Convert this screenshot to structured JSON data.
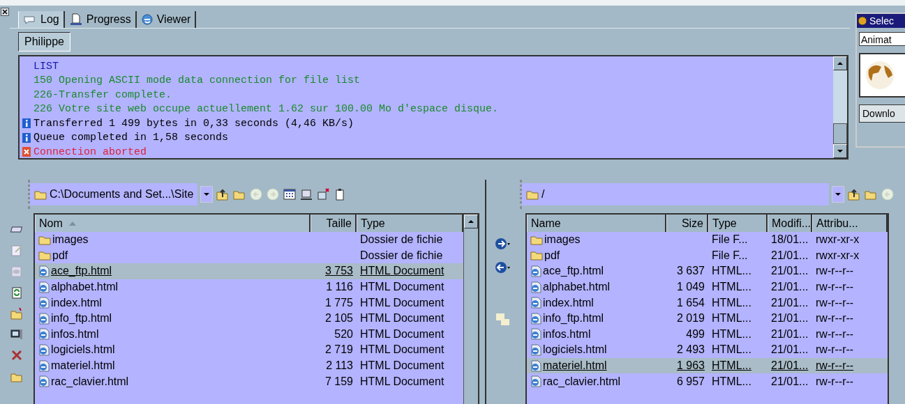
{
  "log_panel": {
    "tabs": [
      {
        "label": "Log",
        "selected": true
      },
      {
        "label": "Progress",
        "selected": false
      },
      {
        "label": "Viewer",
        "selected": false
      }
    ],
    "user_button": "Philippe",
    "lines": [
      {
        "kind": "command",
        "text": "LIST"
      },
      {
        "kind": "reply",
        "text": "150 Opening ASCII mode data connection for file list"
      },
      {
        "kind": "reply",
        "text": "226-Transfer complete."
      },
      {
        "kind": "reply",
        "text": "226 Votre site web occupe actuellement 1.62 sur 100.00 Mo d'espace disque."
      },
      {
        "kind": "info",
        "text": "Transferred 1 499 bytes in 0,33 seconds (4,46 KB/s)"
      },
      {
        "kind": "info",
        "text": "Queue completed in 1,58 seconds"
      },
      {
        "kind": "error",
        "text": "Connection aborted"
      }
    ]
  },
  "side_panel": {
    "title": "Selec",
    "dropdown": "Animat",
    "button": "Downlo"
  },
  "local_pane": {
    "path": "C:\\Documents and Set...\\Site",
    "columns": [
      {
        "label": "Nom",
        "sorted": true
      },
      {
        "label": "Taille",
        "sorted": false
      },
      {
        "label": "Type",
        "sorted": false
      }
    ],
    "rows": [
      {
        "kind": "folder",
        "cells": [
          "images",
          "",
          "Dossier de fichie"
        ],
        "selected": false
      },
      {
        "kind": "folder",
        "cells": [
          "pdf",
          "",
          "Dossier de fichie"
        ],
        "selected": false
      },
      {
        "kind": "file",
        "cells": [
          "ace_ftp.html",
          "3 753",
          "HTML Document"
        ],
        "selected": true
      },
      {
        "kind": "file",
        "cells": [
          "alphabet.html",
          "1 116",
          "HTML Document"
        ],
        "selected": false
      },
      {
        "kind": "file",
        "cells": [
          "index.html",
          "1 775",
          "HTML Document"
        ],
        "selected": false
      },
      {
        "kind": "file",
        "cells": [
          "info_ftp.html",
          "2 105",
          "HTML Document"
        ],
        "selected": false
      },
      {
        "kind": "file",
        "cells": [
          "infos.html",
          "520",
          "HTML Document"
        ],
        "selected": false
      },
      {
        "kind": "file",
        "cells": [
          "logiciels.html",
          "2 719",
          "HTML Document"
        ],
        "selected": false
      },
      {
        "kind": "file",
        "cells": [
          "materiel.html",
          "2 113",
          "HTML Document"
        ],
        "selected": false
      },
      {
        "kind": "file",
        "cells": [
          "rac_clavier.html",
          "7 159",
          "HTML Document"
        ],
        "selected": false
      }
    ]
  },
  "remote_pane": {
    "path": "/",
    "columns": [
      {
        "label": "Name"
      },
      {
        "label": "Size"
      },
      {
        "label": "Type"
      },
      {
        "label": "Modifi..."
      },
      {
        "label": "Attribu..."
      }
    ],
    "rows": [
      {
        "kind": "folder",
        "cells": [
          "images",
          "",
          "File F...",
          "18/01...",
          "rwxr-xr-x"
        ],
        "selected": false
      },
      {
        "kind": "folder",
        "cells": [
          "pdf",
          "",
          "File F...",
          "21/01...",
          "rwxr-xr-x"
        ],
        "selected": false
      },
      {
        "kind": "file",
        "cells": [
          "ace_ftp.html",
          "3 637",
          "HTML...",
          "21/01...",
          "rw-r--r--"
        ],
        "selected": false
      },
      {
        "kind": "file",
        "cells": [
          "alphabet.html",
          "1 049",
          "HTML...",
          "21/01...",
          "rw-r--r--"
        ],
        "selected": false
      },
      {
        "kind": "file",
        "cells": [
          "index.html",
          "1 654",
          "HTML...",
          "21/01...",
          "rw-r--r--"
        ],
        "selected": false
      },
      {
        "kind": "file",
        "cells": [
          "info_ftp.html",
          "2 019",
          "HTML...",
          "21/01...",
          "rw-r--r--"
        ],
        "selected": false
      },
      {
        "kind": "file",
        "cells": [
          "infos.html",
          "499",
          "HTML...",
          "21/01...",
          "rw-r--r--"
        ],
        "selected": false
      },
      {
        "kind": "file",
        "cells": [
          "logiciels.html",
          "2 493",
          "HTML...",
          "21/01...",
          "rw-r--r--"
        ],
        "selected": false
      },
      {
        "kind": "file",
        "cells": [
          "materiel.html",
          "1 963",
          "HTML...",
          "21/01...",
          "rw-r--r--"
        ],
        "selected": true
      },
      {
        "kind": "file",
        "cells": [
          "rac_clavier.html",
          "6 957",
          "HTML...",
          "21/01...",
          "rw-r--r--"
        ],
        "selected": false
      }
    ]
  }
}
